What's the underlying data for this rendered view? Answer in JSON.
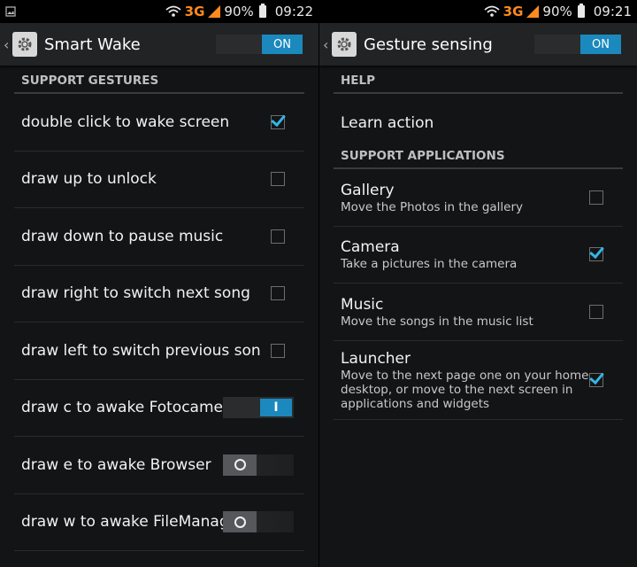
{
  "left": {
    "status": {
      "network": "3G",
      "battery": "90%",
      "time": "09:22"
    },
    "header": {
      "title": "Smart Wake",
      "switch_label": "ON"
    },
    "section": "SUPPORT GESTURES",
    "items": [
      {
        "label": "double click to wake screen",
        "control": "checkbox",
        "checked": true
      },
      {
        "label": "draw up to unlock",
        "control": "checkbox",
        "checked": false
      },
      {
        "label": "draw down to pause music",
        "control": "checkbox",
        "checked": false
      },
      {
        "label": "draw right to switch next song",
        "control": "checkbox",
        "checked": false
      },
      {
        "label": "draw left to switch previous son",
        "control": "checkbox",
        "checked": false
      },
      {
        "label": "draw c to awake Fotocame",
        "control": "toggle",
        "on": true,
        "on_glyph": "I"
      },
      {
        "label": "draw e to awake Browser",
        "control": "toggle",
        "on": false
      },
      {
        "label": "draw w to awake FileManag",
        "control": "toggle",
        "on": false
      }
    ]
  },
  "right": {
    "status": {
      "network": "3G",
      "battery": "90%",
      "time": "09:21"
    },
    "header": {
      "title": "Gesture sensing",
      "switch_label": "ON"
    },
    "help_section": "HELP",
    "help_item": "Learn action",
    "apps_section": "SUPPORT APPLICATIONS",
    "apps": [
      {
        "title": "Gallery",
        "summary": "Move the Photos in the gallery",
        "checked": false
      },
      {
        "title": "Camera",
        "summary": "Take a pictures in the camera",
        "checked": true
      },
      {
        "title": "Music",
        "summary": "Move the songs in the music list",
        "checked": false
      },
      {
        "title": "Launcher",
        "summary": "Move to the next page one on your home desktop, or move to the next screen in applications and widgets",
        "checked": true
      }
    ]
  },
  "colors": {
    "accent": "#1b89bd",
    "check": "#33b5e5",
    "network": "#ff8a1f"
  }
}
